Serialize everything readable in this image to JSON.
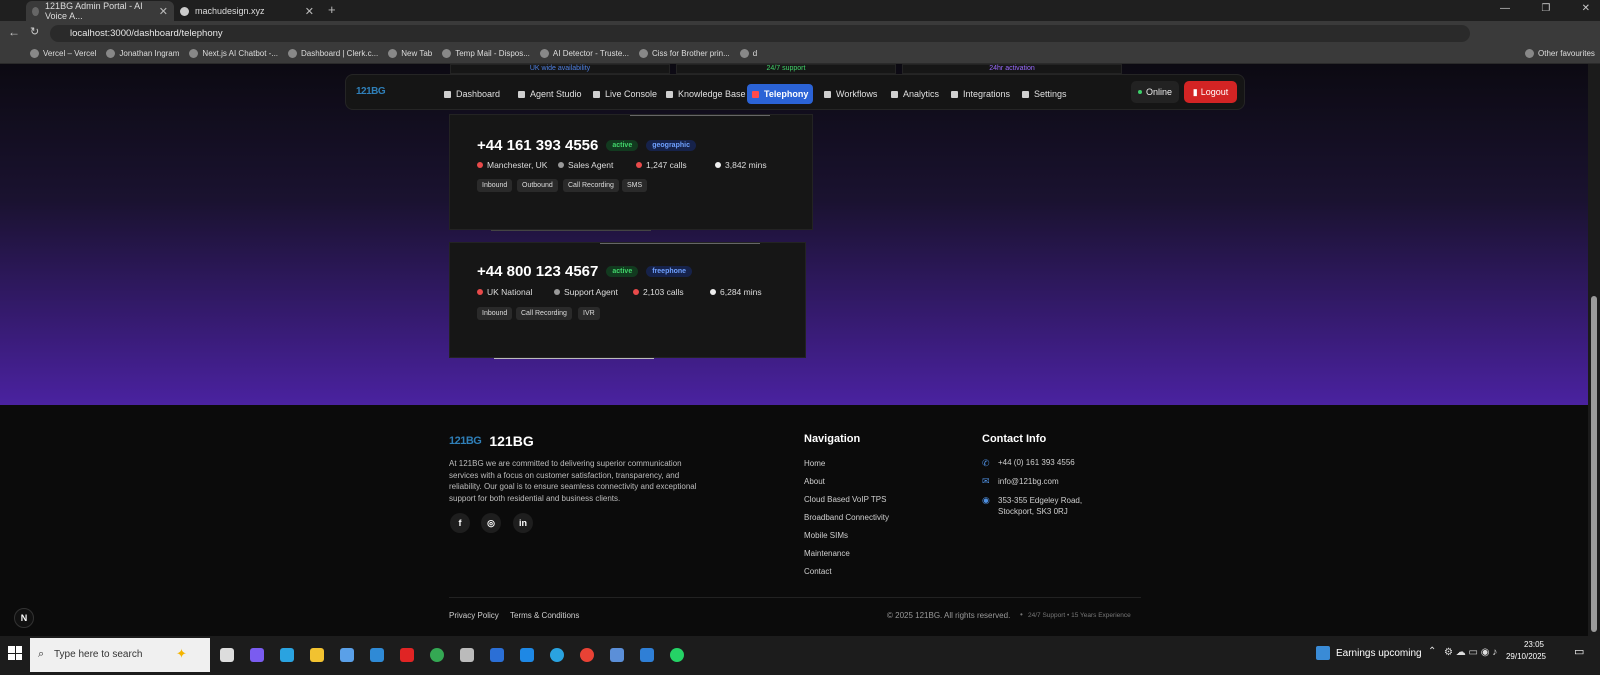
{
  "browser": {
    "tabs": [
      {
        "title": "121BG Admin Portal - AI Voice A..."
      },
      {
        "title": "machudesign.xyz"
      }
    ],
    "url": "localhost:3000/dashboard/telephony",
    "bookmarks": [
      "Vercel – Vercel",
      "Jonathan Ingram",
      "Next.js AI Chatbot -...",
      "Dashboard | Clerk.c...",
      "New Tab",
      "Temp Mail - Dispos...",
      "AI Detector - Truste...",
      "Ciss for Brother prin...",
      "d"
    ],
    "other_favourites": "Other favourites"
  },
  "topnav": {
    "logo": "121BG",
    "items": [
      "Dashboard",
      "Agent Studio",
      "Live Console",
      "Knowledge Base",
      "Telephony",
      "Workflows",
      "Analytics",
      "Integrations",
      "Settings"
    ],
    "active": "Telephony",
    "status": "Online",
    "logout": "Logout"
  },
  "peek": [
    "UK wide availability",
    "24/7 support",
    "24hr activation"
  ],
  "numbers": [
    {
      "number": "+44 161 393 4556",
      "status": "active",
      "type": "geographic",
      "location": "Manchester, UK",
      "agent": "Sales Agent",
      "calls": "1,247 calls",
      "mins": "3,842 mins",
      "features": [
        "Inbound",
        "Outbound",
        "Call Recording",
        "SMS"
      ]
    },
    {
      "number": "+44 800 123 4567",
      "status": "active",
      "type": "freephone",
      "location": "UK National",
      "agent": "Support Agent",
      "calls": "2,103 calls",
      "mins": "6,284 mins",
      "features": [
        "Inbound",
        "Call Recording",
        "IVR"
      ]
    }
  ],
  "footer": {
    "brand": "121BG",
    "logo": "121BG",
    "about": "At 121BG we are committed to delivering superior communication services with a focus on customer satisfaction, transparency, and reliability. Our goal is to ensure seamless connectivity and exceptional support for both residential and business clients.",
    "nav_title": "Navigation",
    "nav": [
      "Home",
      "About",
      "Cloud Based VoIP TPS",
      "Broadband Connectivity",
      "Mobile SIMs",
      "Maintenance",
      "Contact"
    ],
    "contact_title": "Contact Info",
    "phone": "+44 (0) 161 393 4556",
    "email": "info@121bg.com",
    "address1": "353-355 Edgeley Road,",
    "address2": "Stockport, SK3 0RJ",
    "privacy": "Privacy Policy",
    "terms": "Terms & Conditions",
    "copyright": "© 2025 121BG. All rights reserved.",
    "tagline": "24/7 Support • 15 Years Experience"
  },
  "taskbar": {
    "search": "Type here to search",
    "news": "Earnings upcoming",
    "time": "23:05",
    "date": "29/10/2025"
  }
}
